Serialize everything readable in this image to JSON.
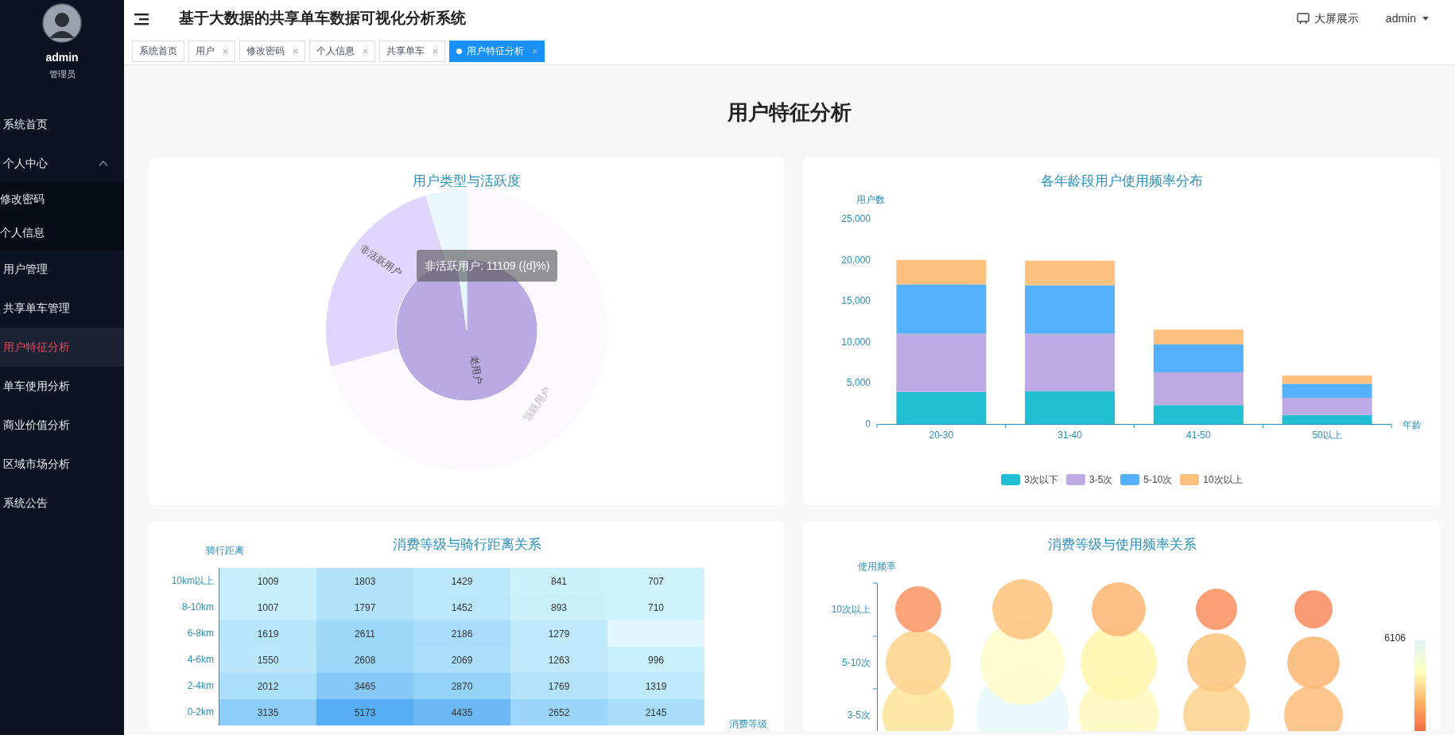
{
  "sidebar": {
    "user": {
      "name": "admin",
      "role": "管理员"
    },
    "items": [
      {
        "label": "系统首页",
        "selected": false
      },
      {
        "label": "个人中心",
        "selected": false,
        "expanded": true,
        "children": [
          {
            "label": "修改密码",
            "selected": false
          },
          {
            "label": "个人信息",
            "selected": false
          }
        ]
      },
      {
        "label": "用户管理",
        "selected": false
      },
      {
        "label": "共享单车管理",
        "selected": false
      },
      {
        "label": "用户特征分析",
        "selected": true
      },
      {
        "label": "单车使用分析",
        "selected": false
      },
      {
        "label": "商业价值分析",
        "selected": false
      },
      {
        "label": "区域市场分析",
        "selected": false
      },
      {
        "label": "系统公告",
        "selected": false
      }
    ]
  },
  "header": {
    "title": "基于大数据的共享单车数据可视化分析系统",
    "screen_button": "大屏展示",
    "user": "admin"
  },
  "tabs": [
    {
      "label": "系统首页",
      "closable": false,
      "selected": false
    },
    {
      "label": "用户",
      "closable": true,
      "selected": false
    },
    {
      "label": "修改密码",
      "closable": true,
      "selected": false
    },
    {
      "label": "个人信息",
      "closable": true,
      "selected": false
    },
    {
      "label": "共享单车",
      "closable": true,
      "selected": false
    },
    {
      "label": "用户特征分析",
      "closable": true,
      "selected": true
    }
  ],
  "page_title": "用户特征分析",
  "panels": [
    {
      "kind": "sunburst",
      "title": "用户类型与活跃度",
      "labels": [
        "非活跃用户",
        "老用户",
        "活跃用户"
      ],
      "tooltip": "非活跃用户: 11109 ({d}%)"
    },
    {
      "kind": "bar",
      "title": "各年龄段用户使用频率分布",
      "chart_data": {
        "type": "bar",
        "stacked": true,
        "ylabel": "用户数",
        "xlabel": "年龄",
        "categories": [
          "20-30",
          "31-40",
          "41-50",
          "50以上"
        ],
        "series": [
          {
            "name": "3次以下",
            "color": "#22bfd2",
            "values": [
              3900,
              4000,
              2300,
              1100
            ]
          },
          {
            "name": "3-5次",
            "color": "#bbaae3",
            "values": [
              7100,
              7000,
              4000,
              2100
            ]
          },
          {
            "name": "5-10次",
            "color": "#55b0fa",
            "values": [
              6000,
              5900,
              3400,
              1700
            ]
          },
          {
            "name": "10次以上",
            "color": "#fdc07f",
            "values": [
              3000,
              3000,
              1800,
              1000
            ]
          }
        ],
        "ylim": [
          0,
          25000
        ],
        "yticks": [
          {
            "value": 0,
            "label": "0"
          },
          {
            "value": 5000,
            "label": "5,000"
          },
          {
            "value": 10000,
            "label": "10,000"
          },
          {
            "value": 15000,
            "label": "15,000"
          },
          {
            "value": 20000,
            "label": "20,000"
          },
          {
            "value": 25000,
            "label": "25,000"
          }
        ]
      }
    },
    {
      "kind": "heatmap",
      "title": "消费等级与骑行距离关系",
      "ylabel": "骑行距离",
      "xlabel": "消费等级",
      "rows": [
        {
          "label": "10km以上",
          "cells": [
            "1009",
            "1803",
            "1429",
            "841",
            "707"
          ]
        },
        {
          "label": "8-10km",
          "cells": [
            "1007",
            "1797",
            "1452",
            "893",
            "710"
          ]
        },
        {
          "label": "6-8km",
          "cells": [
            "1619",
            "2611",
            "2186",
            "1279"
          ]
        },
        {
          "label": "4-6km",
          "cells": [
            "1550",
            "2608",
            "2069",
            "1263",
            "996"
          ]
        },
        {
          "label": "2-4km",
          "cells": [
            "2012",
            "3465",
            "2870",
            "1769",
            "1319"
          ]
        },
        {
          "label": "0-2km",
          "cells": [
            "3135",
            "5173",
            "4435",
            "2652",
            "2145"
          ]
        }
      ]
    },
    {
      "kind": "bubble",
      "title": "消费等级与使用频率关系",
      "ylabel": "使用频率",
      "y_labels": [
        "10次以上",
        "5-10次",
        "3-5次"
      ],
      "scale_max": "6106"
    }
  ]
}
